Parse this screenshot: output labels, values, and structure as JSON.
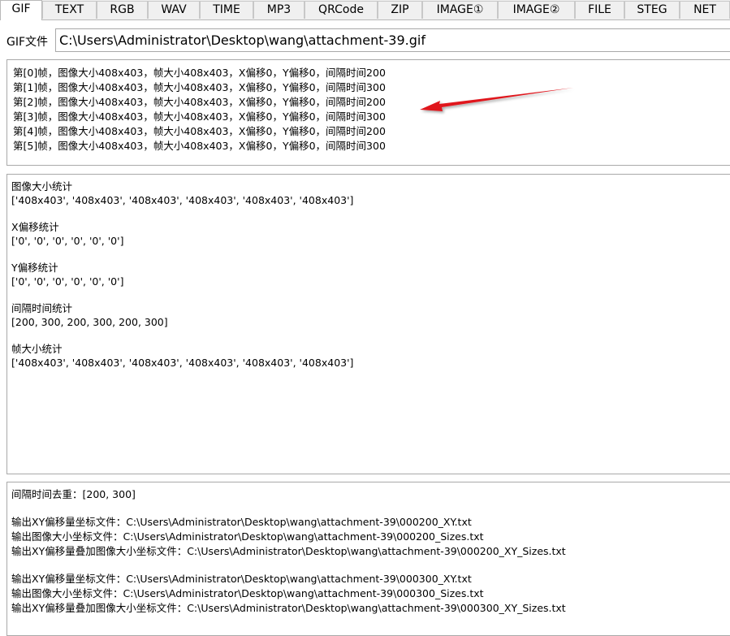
{
  "tabs": [
    {
      "label": "GIF",
      "active": true
    },
    {
      "label": "TEXT"
    },
    {
      "label": "RGB"
    },
    {
      "label": "WAV"
    },
    {
      "label": "TIME"
    },
    {
      "label": "MP3"
    },
    {
      "label": "QRCode"
    },
    {
      "label": "ZIP"
    },
    {
      "label": "IMAGE①"
    },
    {
      "label": "IMAGE②"
    },
    {
      "label": "FILE"
    },
    {
      "label": "STEG"
    },
    {
      "label": "NET"
    }
  ],
  "file": {
    "label": "GIF文件",
    "path": "C:\\Users\\Administrator\\Desktop\\wang\\attachment-39.gif"
  },
  "frames": [
    "第[0]帧，图像大小408x403，帧大小408x403，X偏移0，Y偏移0，间隔时间200",
    "第[1]帧，图像大小408x403，帧大小408x403，X偏移0，Y偏移0，间隔时间300",
    "第[2]帧，图像大小408x403，帧大小408x403，X偏移0，Y偏移0，间隔时间200",
    "第[3]帧，图像大小408x403，帧大小408x403，X偏移0，Y偏移0，间隔时间300",
    "第[4]帧，图像大小408x403，帧大小408x403，X偏移0，Y偏移0，间隔时间200",
    "第[5]帧，图像大小408x403，帧大小408x403，X偏移0，Y偏移0，间隔时间300"
  ],
  "stats": {
    "image_size_title": "图像大小统计",
    "image_size_values": "['408x403', '408x403', '408x403', '408x403', '408x403', '408x403']",
    "x_offset_title": "X偏移统计",
    "x_offset_values": "['0', '0', '0', '0', '0', '0']",
    "y_offset_title": "Y偏移统计",
    "y_offset_values": "['0', '0', '0', '0', '0', '0']",
    "interval_title": "间隔时间统计",
    "interval_values": "[200, 300, 200, 300, 200, 300]",
    "frame_size_title": "帧大小统计",
    "frame_size_values": "['408x403', '408x403', '408x403', '408x403', '408x403', '408x403']"
  },
  "output": {
    "dedupe": "间隔时间去重：[200, 300]",
    "group1": [
      "输出XY偏移量坐标文件：C:\\Users\\Administrator\\Desktop\\wang\\attachment-39\\000200_XY.txt",
      "输出图像大小坐标文件：C:\\Users\\Administrator\\Desktop\\wang\\attachment-39\\000200_Sizes.txt",
      "输出XY偏移量叠加图像大小坐标文件：C:\\Users\\Administrator\\Desktop\\wang\\attachment-39\\000200_XY_Sizes.txt"
    ],
    "group2": [
      "输出XY偏移量坐标文件：C:\\Users\\Administrator\\Desktop\\wang\\attachment-39\\000300_XY.txt",
      "输出图像大小坐标文件：C:\\Users\\Administrator\\Desktop\\wang\\attachment-39\\000300_Sizes.txt",
      "输出XY偏移量叠加图像大小坐标文件：C:\\Users\\Administrator\\Desktop\\wang\\attachment-39\\000300_XY_Sizes.txt"
    ]
  },
  "colors": {
    "arrow": "#e0161e",
    "border": "#a9a9a9",
    "tab_bg": "#f0f0f0"
  }
}
